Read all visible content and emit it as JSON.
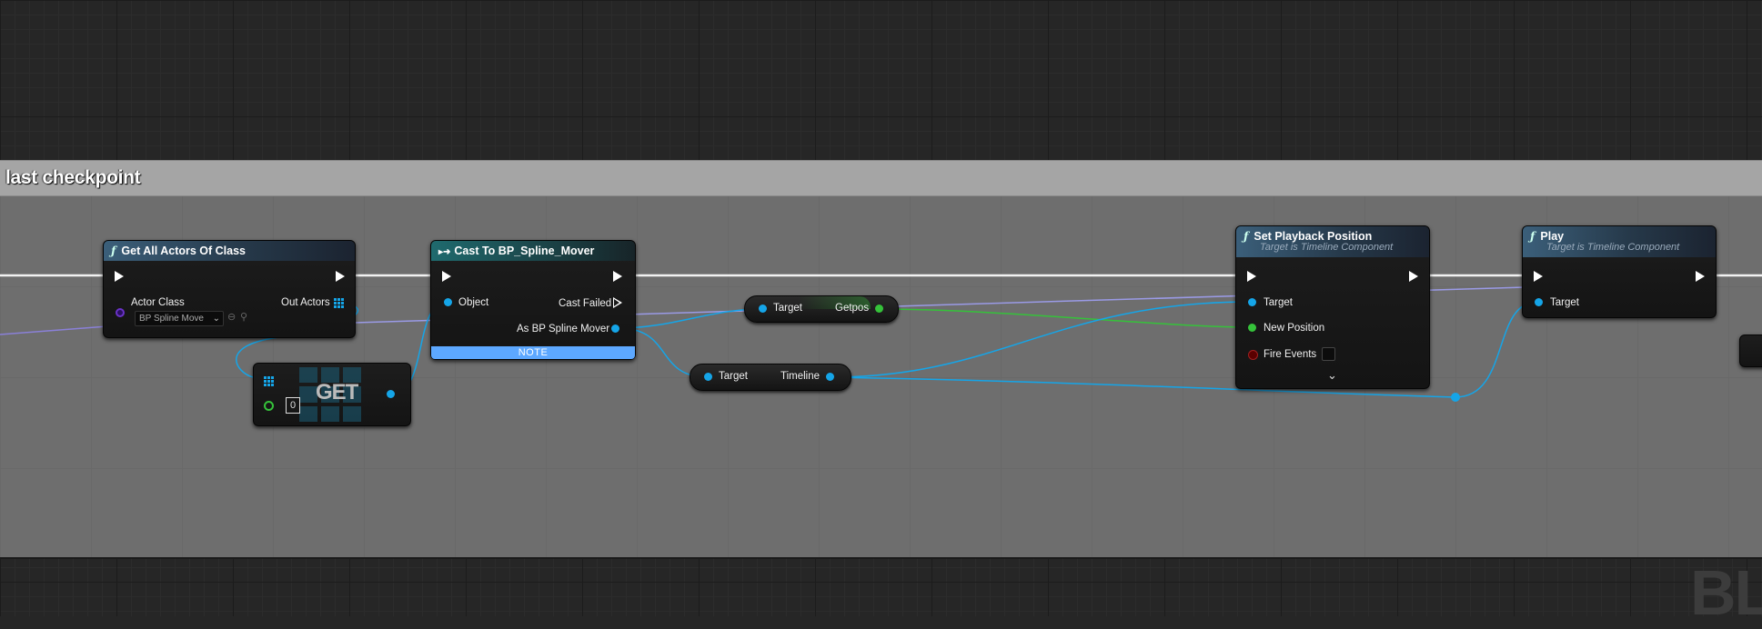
{
  "comment": {
    "title": "last checkpoint"
  },
  "nodes": {
    "get_all_actors": {
      "title": "Get All Actors Of Class",
      "actor_class_label": "Actor Class",
      "actor_class_value": "BP Spline Move",
      "out_actors_label": "Out Actors"
    },
    "cast": {
      "title": "Cast To BP_Spline_Mover",
      "object_label": "Object",
      "cast_failed_label": "Cast Failed",
      "as_label": "As BP Spline Mover",
      "note": "NOTE"
    },
    "get_array": {
      "label": "GET",
      "index": "0"
    },
    "getpos": {
      "target": "Target",
      "out": "Getpos"
    },
    "timeline_var": {
      "target": "Target",
      "out": "Timeline"
    },
    "set_playback": {
      "title": "Set Playback Position",
      "subtitle": "Target is Timeline Component",
      "target_label": "Target",
      "new_position_label": "New Position",
      "fire_events_label": "Fire Events"
    },
    "play": {
      "title": "Play",
      "subtitle": "Target is Timeline Component",
      "target_label": "Target"
    }
  },
  "watermark": "BL",
  "colors": {
    "exec": "#ffffff",
    "object_pin": "#15a5e8",
    "float_pin": "#35c23a",
    "class_pin": "#6a32c8",
    "bool_pin": "#a02020",
    "note": "#5da8ff",
    "comment_header": "#a5a5a5"
  }
}
